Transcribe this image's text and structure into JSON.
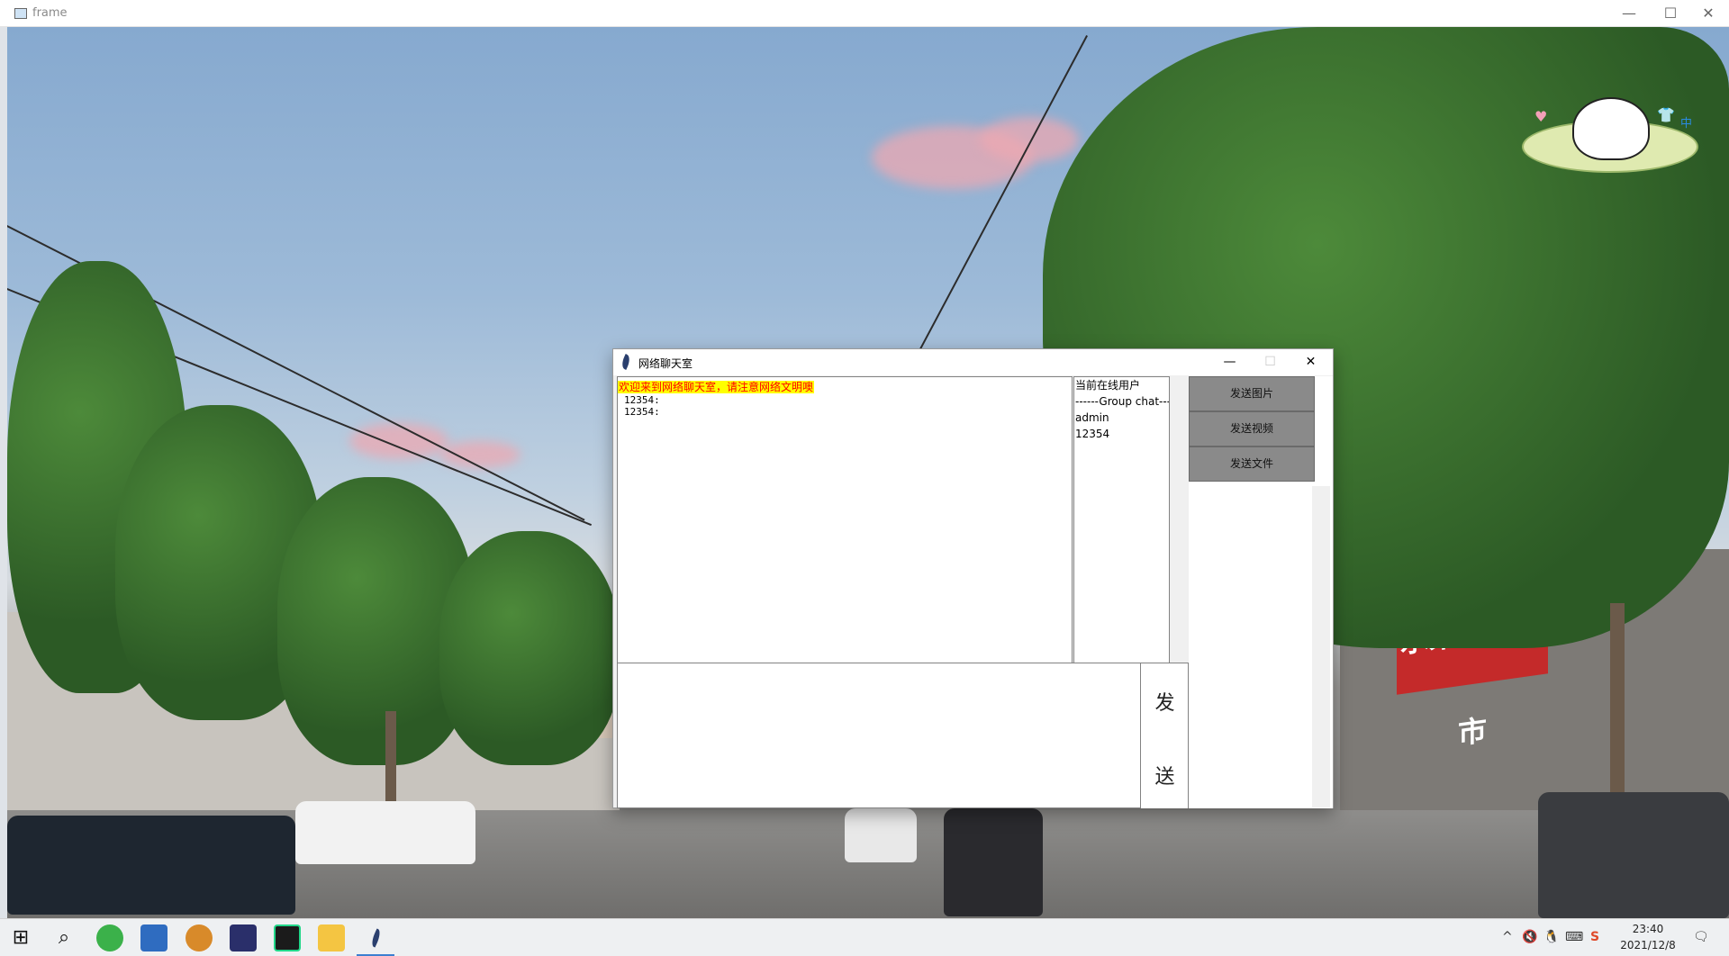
{
  "frame": {
    "title": "frame",
    "minimize": "—",
    "maximize": "☐",
    "close": "✕"
  },
  "pet": {
    "heart": "♥",
    "shirt": "👕",
    "lang": "中"
  },
  "wallpaper": {
    "shop_sign": "水果蔬菜超市"
  },
  "chat": {
    "title": "网络聊天室",
    "minimize": "—",
    "maximize": "☐",
    "close": "✕",
    "welcome": "欢迎来到网络聊天室，请注意网络文明噢",
    "messages": [
      "12354:",
      "12354:"
    ],
    "users": [
      "当前在线用户",
      "------Group chat------",
      "admin",
      "12354"
    ],
    "buttons": {
      "send_image": "发送图片",
      "send_video": "发送视频",
      "send_file": "发送文件"
    },
    "send_label_top": "发",
    "send_label_bottom": "送"
  },
  "taskbar": {
    "start": "⊞",
    "search": "⌕",
    "apps": [
      "green-app-icon",
      "remote-desktop-icon",
      "bear-app-icon",
      "ide-icon",
      "pycharm-icon",
      "file-explorer-icon",
      "feather-app-icon"
    ],
    "tray": {
      "chevron": "^",
      "volume": "🔇",
      "qq": "🐧",
      "network": "⌨",
      "app": "S",
      "notify": "🗨"
    },
    "time": "23:40",
    "date": "2021/12/8"
  },
  "colors": {
    "welcome_bg": "#ffff00",
    "welcome_fg": "#ff0000",
    "side_button_bg": "#8a8a8a",
    "taskbar_bg": "#eef0f2"
  }
}
